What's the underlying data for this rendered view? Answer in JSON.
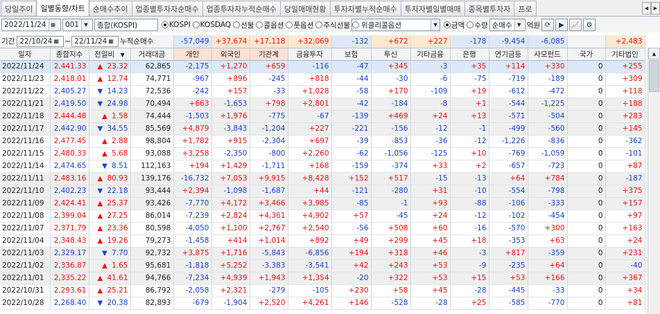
{
  "tabs": [
    "당일추이",
    "일별동향/차트",
    "순매수추이",
    "업종별투자자순매수",
    "업종투자자누적순매수",
    "당일매매현황",
    "투자자별누적순매수",
    "투자자별일별매매",
    "종목별투자자",
    "프로"
  ],
  "active_tab": 1,
  "toolbar": {
    "date": "2022/11/24",
    "code": "001",
    "market_name": "종합(KOSPI)",
    "radios_market": [
      {
        "label": "KOSPI",
        "checked": true
      },
      {
        "label": "KOSDAQ",
        "checked": false
      },
      {
        "label": "선물",
        "checked": false
      },
      {
        "label": "콜옵션",
        "checked": false
      },
      {
        "label": "풋옵션",
        "checked": false
      },
      {
        "label": "주식선물",
        "checked": false
      }
    ],
    "weekly": "위클리콜옵션",
    "radios_unit": [
      {
        "label": "금액",
        "checked": true
      },
      {
        "label": "수량",
        "checked": false
      }
    ],
    "trade_type": "순매수",
    "unit_label": "억원"
  },
  "period": {
    "label": "기간",
    "from": "22/10/24",
    "tilde": "~",
    "to": "22/11/24",
    "cum_label": "누적순매수",
    "cum_values": [
      "-57,049",
      "+37,674",
      "+17,118",
      "+32,069",
      "-132",
      "+672",
      "+227",
      "-178",
      "-9,454",
      "-6,085",
      "",
      "+2,483"
    ]
  },
  "columns": [
    "일자",
    "종합지수",
    "전일비",
    "거래대금",
    "개인",
    "외국인",
    "기관계",
    "금융투자",
    "보험",
    "투신",
    "기타금융",
    "은행",
    "연기금등",
    "사모펀드",
    "국가",
    "기타법인"
  ],
  "rows": [
    [
      "2022/11/24",
      "2,441.33",
      "up",
      "23.32",
      "62,865",
      "-2,175",
      "+1,270",
      "+659",
      "-116",
      "-47",
      "+345",
      "-3",
      "+35",
      "+114",
      "+330",
      "0",
      "+255"
    ],
    [
      "2022/11/23",
      "2,418.01",
      "up",
      "12.74",
      "74,771",
      "-967",
      "+896",
      "-245",
      "+818",
      "-44",
      "-30",
      "-6",
      "-75",
      "-719",
      "-189",
      "0",
      "+309"
    ],
    [
      "2022/11/22",
      "2,405.27",
      "dn",
      "14.23",
      "72,536",
      "-242",
      "+157",
      "-33",
      "+1,028",
      "-58",
      "+170",
      "-109",
      "+19",
      "-612",
      "-472",
      "0",
      "+118"
    ],
    [
      "2022/11/21",
      "2,419.50",
      "dn",
      "24.98",
      "70,494",
      "+663",
      "-1,653",
      "+798",
      "+2,801",
      "-42",
      "-184",
      "-8",
      "+1",
      "-544",
      "-1,225",
      "0",
      "+188"
    ],
    [
      "2022/11/18",
      "2,444.48",
      "up",
      "1.58",
      "74,444",
      "-1,503",
      "+1,976",
      "-775",
      "-67",
      "-139",
      "+469",
      "+24",
      "+13",
      "-571",
      "-504",
      "0",
      "+283"
    ],
    [
      "2022/11/17",
      "2,442.90",
      "dn",
      "34.55",
      "85,569",
      "+4,879",
      "-3,843",
      "-1,204",
      "+227",
      "-221",
      "-156",
      "-12",
      "-1",
      "-499",
      "-560",
      "0",
      "+145"
    ],
    [
      "2022/11/16",
      "2,477.45",
      "up",
      "2.88",
      "98,804",
      "+1,782",
      "+915",
      "-2,304",
      "+697",
      "-39",
      "-853",
      "-36",
      "-12",
      "-1,226",
      "-836",
      "0",
      "-362"
    ],
    [
      "2022/11/15",
      "2,480.33",
      "up",
      "5.68",
      "93,088",
      "+3,258",
      "-2,350",
      "-800",
      "+2,260",
      "-62",
      "-1,056",
      "-125",
      "+10",
      "-769",
      "-1,059",
      "0",
      "-101"
    ],
    [
      "2022/11/14",
      "2,474.65",
      "dn",
      "8.51",
      "112,163",
      "+194",
      "+1,429",
      "-1,711",
      "+168",
      "-159",
      "-374",
      "+33",
      "+2",
      "-657",
      "-723",
      "0",
      "+87"
    ],
    [
      "2022/11/11",
      "2,483.16",
      "up",
      "80.93",
      "139,176",
      "-16,732",
      "+7,053",
      "+9,915",
      "+8,428",
      "+152",
      "+517",
      "-15",
      "-13",
      "+64",
      "+784",
      "0",
      "-187"
    ],
    [
      "2022/11/10",
      "2,402.23",
      "dn",
      "22.18",
      "93,444",
      "+2,394",
      "-1,098",
      "-1,687",
      "+44",
      "-121",
      "-280",
      "+31",
      "-10",
      "-554",
      "-798",
      "0",
      "+375"
    ],
    [
      "2022/11/09",
      "2,424.41",
      "up",
      "25.37",
      "93,426",
      "-7,770",
      "+4,172",
      "+3,466",
      "+3,985",
      "-85",
      "-1",
      "+93",
      "-88",
      "-106",
      "-333",
      "0",
      "+157"
    ],
    [
      "2022/11/08",
      "2,399.04",
      "up",
      "27.25",
      "86,014",
      "-7,239",
      "+2,824",
      "+4,361",
      "+4,902",
      "+57",
      "-45",
      "+24",
      "-12",
      "-102",
      "-454",
      "0",
      "+97"
    ],
    [
      "2022/11/07",
      "2,371.79",
      "up",
      "23.36",
      "80,598",
      "-4,050",
      "+1,100",
      "+2,767",
      "+2,540",
      "-56",
      "+508",
      "+60",
      "-16",
      "-570",
      "+300",
      "0",
      "+163"
    ],
    [
      "2022/11/04",
      "2,348.43",
      "up",
      "19.26",
      "79,273",
      "-1,458",
      "+414",
      "+1,014",
      "+892",
      "+49",
      "+299",
      "+45",
      "+18",
      "-353",
      "+63",
      "0",
      "+24"
    ],
    [
      "2022/11/03",
      "2,329.17",
      "dn",
      "7.70",
      "92,732",
      "+3,875",
      "+1,716",
      "-5,843",
      "-6,856",
      "+194",
      "+318",
      "+46",
      "-3",
      "+817",
      "-359",
      "0",
      "+231"
    ],
    [
      "2022/11/02",
      "2,336.87",
      "up",
      "1.65",
      "95,681",
      "-1,818",
      "+5,252",
      "-3,383",
      "-3,541",
      "+42",
      "+243",
      "+53",
      "-9",
      "-235",
      "+64",
      "0",
      "-40"
    ],
    [
      "2022/11/01",
      "2,335.22",
      "up",
      "41.61",
      "94,766",
      "-7,234",
      "+4,939",
      "+1,943",
      "+1,354",
      "-20",
      "+322",
      "+53",
      "+15",
      "+53",
      "+166",
      "0",
      "+367"
    ],
    [
      "2022/10/31",
      "2,293.61",
      "up",
      "25.21",
      "86,792",
      "-2,058",
      "+2,321",
      "-279",
      "-105",
      "+230",
      "+58",
      "+45",
      "-28",
      "-445",
      "-33",
      "0",
      "+34"
    ],
    [
      "2022/10/28",
      "2,268.40",
      "dn",
      "20.38",
      "82,893",
      "-679",
      "-1,904",
      "+2,520",
      "+4,261",
      "+146",
      "-528",
      "-28",
      "+25",
      "-585",
      "-770",
      "0",
      "+81"
    ]
  ]
}
